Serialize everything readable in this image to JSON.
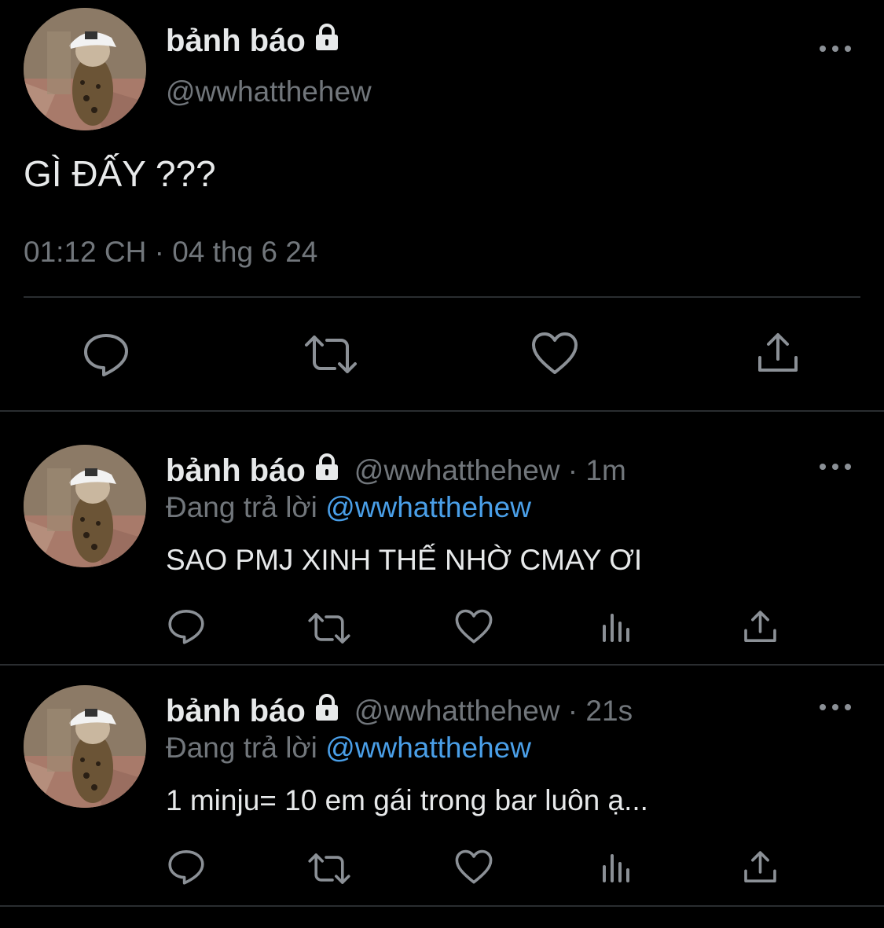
{
  "main_tweet": {
    "display_name": "bảnh báo",
    "handle": "@wwhatthehew",
    "text": "GÌ ĐẤY ???",
    "timestamp": "01:12 CH · 04 thg 6 24",
    "icons": [
      "reply-icon",
      "retweet-icon",
      "like-icon",
      "share-icon"
    ]
  },
  "replies": [
    {
      "display_name": "bảnh báo",
      "handle_time": "@wwhatthehew · 1m",
      "reply_prefix": "Đang trả lời",
      "reply_to": "@wwhatthehew",
      "text": "SAO PMJ XINH THẾ NHỜ CMAY ƠI"
    },
    {
      "display_name": "bảnh báo",
      "handle_time": "@wwhatthehew · 21s",
      "reply_prefix": "Đang trả lời",
      "reply_to": "@wwhatthehew",
      "text": "1 minju= 10 em gái trong bar luôn ạ..."
    }
  ],
  "colors": {
    "background": "#000000",
    "text": "#e7e9ea",
    "muted": "#71767b",
    "link": "#4a9fe8",
    "divider": "#2a2d30"
  }
}
